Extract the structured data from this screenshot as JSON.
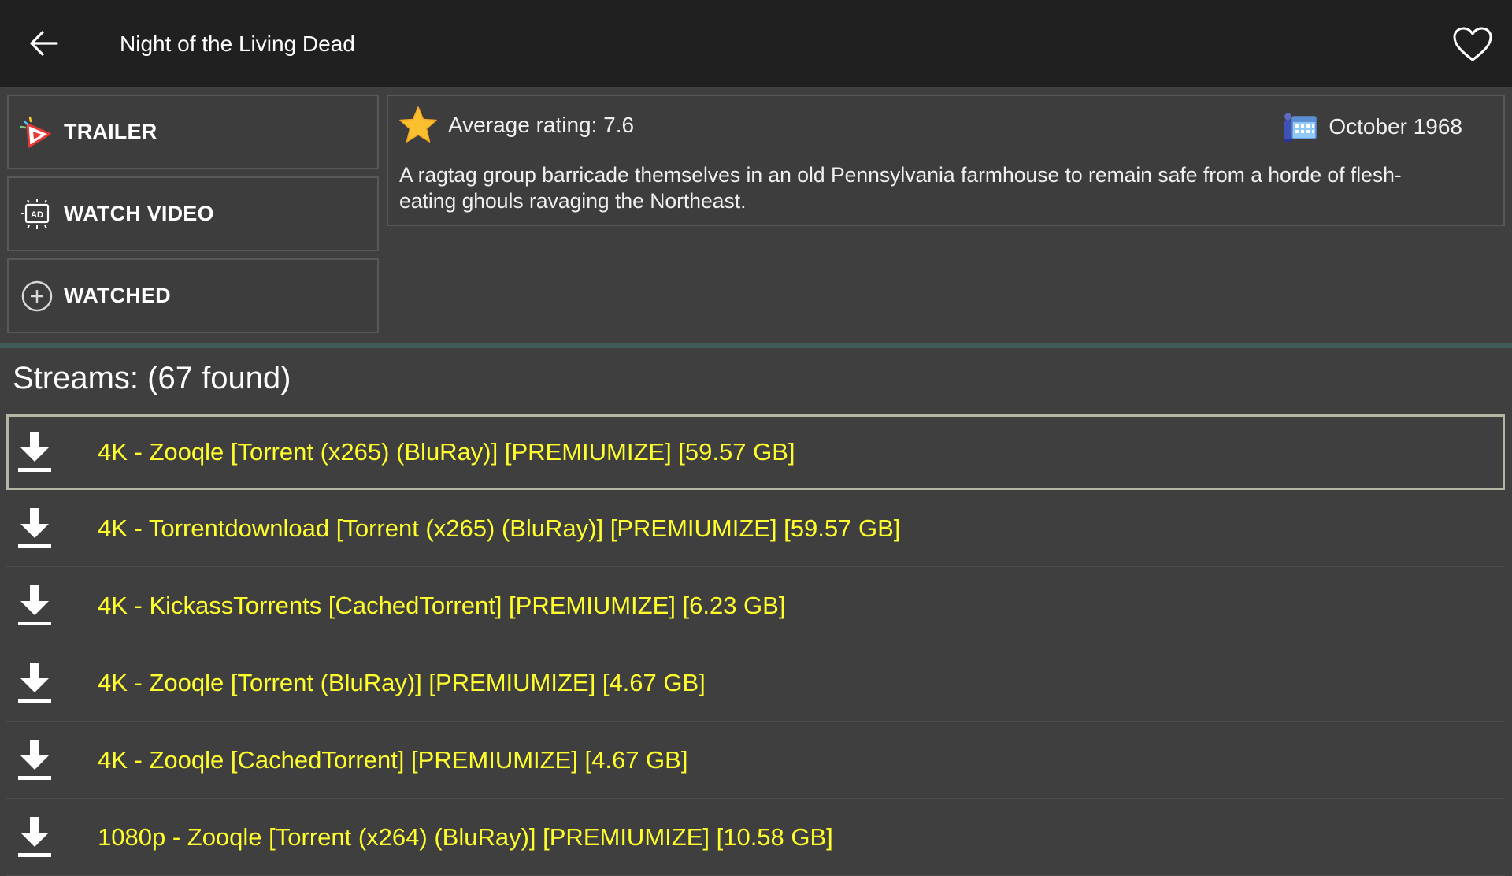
{
  "appbar": {
    "title": "Night of the Living Dead",
    "back_icon": "arrow-left-icon",
    "favorite_icon": "heart-outline-icon"
  },
  "actions": [
    {
      "label": "TRAILER",
      "icon": "play-trailer-icon"
    },
    {
      "label": "WATCH VIDEO",
      "icon": "ad-video-icon"
    },
    {
      "label": "WATCHED",
      "icon": "plus-circle-icon"
    }
  ],
  "info": {
    "rating_text": "Average rating: 7.6",
    "release_date": "October 1968",
    "description": "A ragtag group barricade themselves in an old Pennsylvania farmhouse to remain safe from a horde of flesh-eating ghouls ravaging the Northeast."
  },
  "streams": {
    "header": "Streams: (67 found)",
    "items": [
      "4K - Zooqle [Torrent (x265) (BluRay)] [PREMIUMIZE] [59.57 GB]",
      "4K - Torrentdownload [Torrent (x265) (BluRay)] [PREMIUMIZE] [59.57 GB]",
      "4K - KickassTorrents [CachedTorrent] [PREMIUMIZE] [6.23 GB]",
      "4K - Zooqle [Torrent (BluRay)] [PREMIUMIZE] [4.67 GB]",
      "4K - Zooqle [CachedTorrent] [PREMIUMIZE] [4.67 GB]",
      "1080p - Zooqle [Torrent (x264) (BluRay)] [PREMIUMIZE] [10.58 GB]"
    ]
  },
  "colors": {
    "appbar_bg": "#202020",
    "page_bg": "#3f3f3f",
    "stream_text": "#ffff2e",
    "divider": "#3f5a57"
  }
}
